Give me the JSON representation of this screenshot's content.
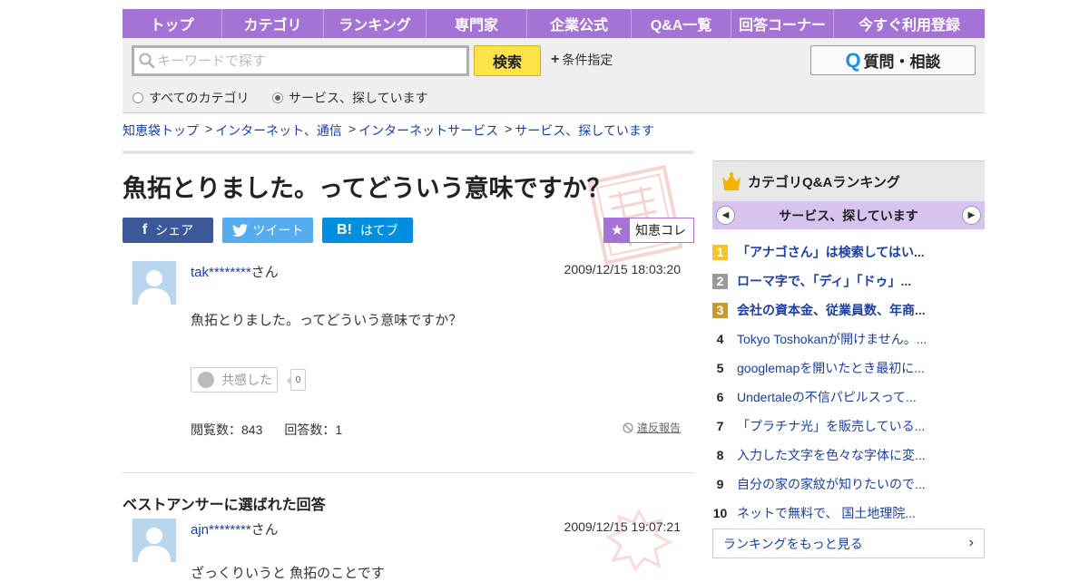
{
  "nav": {
    "items": [
      "トップ",
      "カテゴリ",
      "ランキング",
      "専門家",
      "企業公式",
      "Q&A一覧",
      "回答コーナー",
      "今すぐ利用登録"
    ]
  },
  "search": {
    "placeholder": "キーワードで探す",
    "button_label": "検索",
    "condition_label": "条件指定",
    "ask_label": "質問・相談",
    "scope_all": "すべてのカテゴリ",
    "scope_current": "サービス、探しています"
  },
  "breadcrumb": [
    "知恵袋トップ",
    "インターネット、通信",
    "インターネットサービス",
    "サービス、探しています"
  ],
  "question": {
    "title": "魚拓とりました。ってどういう意味ですか？",
    "share_labels": {
      "facebook": "シェア",
      "twitter": "ツイート",
      "hatena": "はてブ"
    },
    "collect_label": "知恵コレ",
    "user_id": "tak********",
    "user_suffix": "さん",
    "date": "2009/12/15  18:03:20",
    "body": "魚拓とりました。ってどういう意味ですか？",
    "empathy_label": "共感した",
    "empathy_count": "0",
    "views": "閲覧数：843",
    "answers": "回答数：1",
    "report_label": "違反報告"
  },
  "best_answer": {
    "heading": "ベストアンサーに選ばれた回答",
    "user_id": "ajn********",
    "user_suffix": "さん",
    "date": "2009/12/15  19:07:21",
    "body": "ざっくりいうと 魚拓のことです"
  },
  "ranking": {
    "title": "カテゴリQ&Aランキング",
    "category": "サービス、探しています",
    "items": [
      {
        "num": "1",
        "title": "「アナゴさん」は検索してはい..."
      },
      {
        "num": "2",
        "title": "ローマ字で、「ディ」「ドゥ」..."
      },
      {
        "num": "3",
        "title": "会社の資本金、従業員数、年商..."
      },
      {
        "num": "4",
        "title": "Tokyo Toshokanが開けません。..."
      },
      {
        "num": "5",
        "title": "googlemapを開いたとき最初に..."
      },
      {
        "num": "6",
        "title": "Undertaleの不信パピルスって..."
      },
      {
        "num": "7",
        "title": "「プラチナ光」を販売している..."
      },
      {
        "num": "8",
        "title": "入力した文字を色々な字体に変..."
      },
      {
        "num": "9",
        "title": "自分の家の家紋が知りたいので..."
      },
      {
        "num": "10",
        "title": "ネットで無料で、 国土地理院..."
      }
    ],
    "more_label": "ランキングをもっと見る"
  },
  "colors": {
    "nav_purple": "#a572d6",
    "search_yellow": "#fde34a",
    "link_blue": "#1b3ea8",
    "facebook": "#3b5998",
    "twitter": "#55acee",
    "hatena": "#008fde"
  }
}
